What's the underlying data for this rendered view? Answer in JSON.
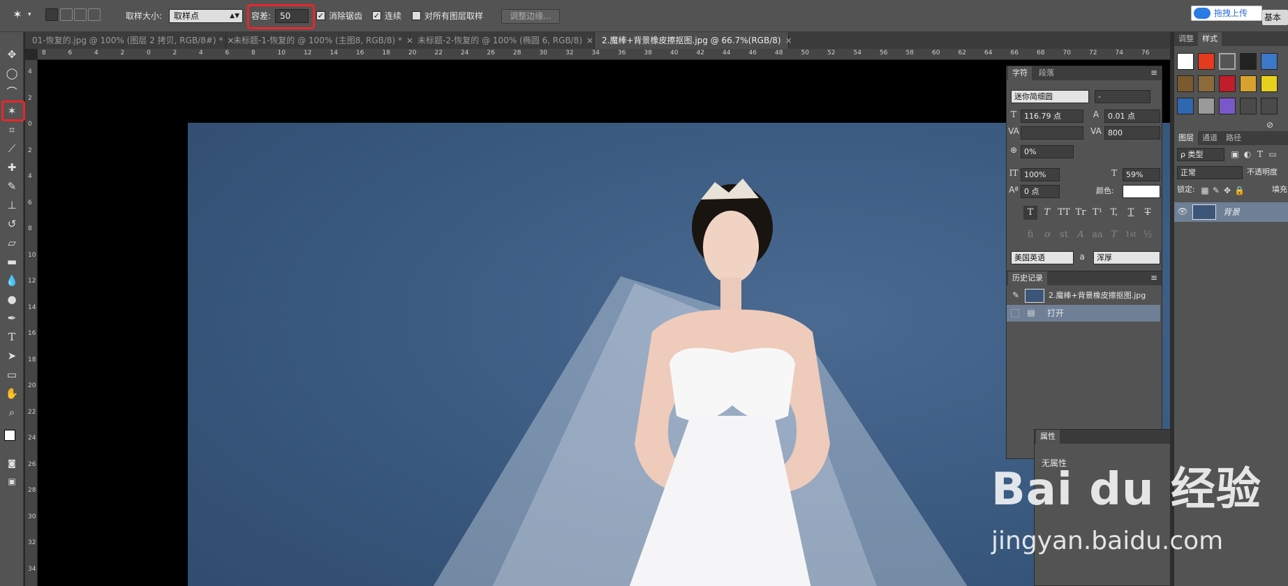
{
  "options_bar": {
    "sample_size_label": "取样大小:",
    "sample_size_value": "取样点",
    "tolerance_label": "容差:",
    "tolerance_value": "50",
    "antialias_label": "消除锯齿",
    "contiguous_label": "连续",
    "all_layers_label": "对所有图层取样",
    "refine_edge_label": "调整边缘...",
    "upload_label": "拖拽上传",
    "workspace_label": "基本功"
  },
  "doc_tabs": [
    {
      "label": "01-恢复的.jpg @ 100% (图层 2 拷贝, RGB/8#) *"
    },
    {
      "label": "未标题-1-恢复的 @ 100% (主图8, RGB/8) *"
    },
    {
      "label": "未标题-2-恢复的 @ 100% (椭圆 6, RGB/8)"
    },
    {
      "label": "2.魔棒+背景橡皮擦抠图.jpg @ 66.7%(RGB/8)"
    }
  ],
  "ruler_top": [
    "8",
    "6",
    "4",
    "2",
    "0",
    "2",
    "4",
    "6",
    "8",
    "10",
    "12",
    "14",
    "16",
    "18",
    "20",
    "22",
    "24",
    "26",
    "28",
    "30",
    "32",
    "34",
    "36",
    "38",
    "40",
    "42",
    "44",
    "46",
    "48",
    "50",
    "52",
    "54",
    "56",
    "58",
    "60",
    "62",
    "64",
    "66",
    "68",
    "70",
    "72",
    "74",
    "76"
  ],
  "ruler_left": [
    "4",
    "2",
    "0",
    "2",
    "4",
    "6",
    "8",
    "10",
    "12",
    "14",
    "16",
    "18",
    "20",
    "22",
    "24",
    "26",
    "28",
    "30",
    "32",
    "34"
  ],
  "character_panel": {
    "tab_char": "字符",
    "tab_para": "段落",
    "font_family": "迷你简细圆",
    "font_style": "-",
    "font_size": "116.79 点",
    "leading": "0.01 点",
    "kerning": "",
    "tracking": "800",
    "scale_ratio": "0%",
    "vscale": "100%",
    "hscale": "59%",
    "baseline": "0 点",
    "color_label": "颜色:",
    "color_value": "#ffffff",
    "language": "美国英语",
    "aa_icon": "a",
    "aa_method": "浑厚",
    "style_buttons": [
      "T",
      "T",
      "TT",
      "Tr",
      "T¹",
      "T,",
      "T",
      "T"
    ],
    "otype_buttons": [
      "fi",
      "ơ",
      "st",
      "A",
      "aa",
      "T",
      "1st",
      "½"
    ]
  },
  "history_panel": {
    "title": "历史记录",
    "snapshot_label": "2.魔棒+背景橡皮擦抠图.jpg",
    "items": [
      {
        "label": "打开"
      }
    ]
  },
  "properties_panel": {
    "title": "属性",
    "body": "无属性"
  },
  "right_dock": {
    "tab_adjust": "调整",
    "tab_styles": "样式",
    "tab_layers": "图层",
    "tab_channels": "通道",
    "tab_paths": "路径",
    "filter_type": "ρ 类型",
    "blend_mode": "正常",
    "opacity_label": "不透明度",
    "lock_label": "锁定:",
    "fill_label": "填充",
    "layer_name": "背景"
  },
  "watermark": {
    "brand": "Bai du 经验",
    "url": "jingyan.baidu.com"
  }
}
